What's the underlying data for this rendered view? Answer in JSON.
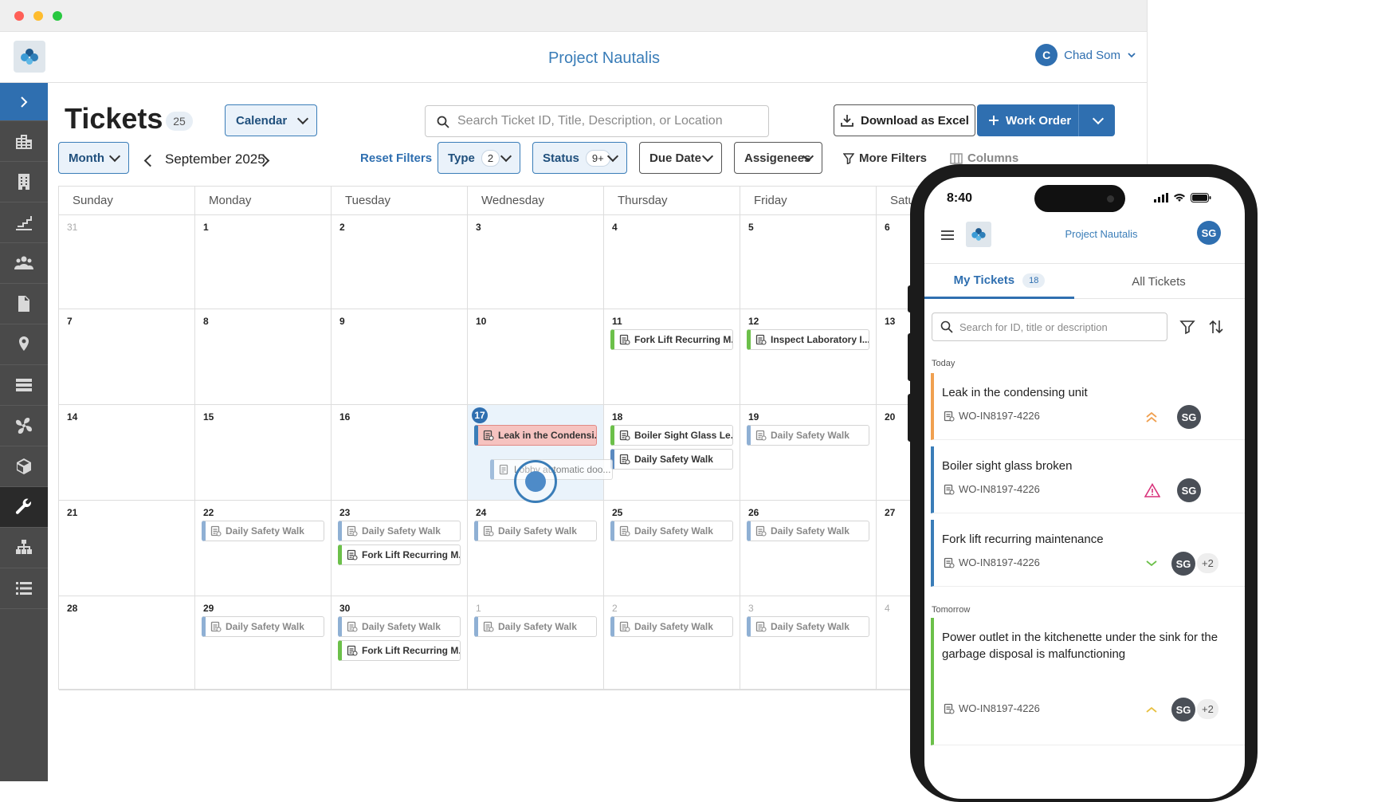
{
  "app": {
    "title": "Project Nautalis",
    "user_initial": "C",
    "user_name": "Chad Som"
  },
  "header": {
    "title": "Tickets",
    "count": "25",
    "view_select": "Calendar",
    "search_placeholder": "Search Ticket ID, Title, Description, or Location",
    "download_label": "Download as Excel",
    "work_order_label": "Work Order"
  },
  "filters": {
    "period": "Month",
    "month_label": "September 2025",
    "reset": "Reset Filters",
    "type_label": "Type",
    "type_count": "2",
    "status_label": "Status",
    "status_count": "9+",
    "due_date": "Due Date",
    "assignees": "Assigenees",
    "more_filters": "More Filters",
    "columns": "Columns"
  },
  "sidebar": {
    "icons": [
      "chevron-right-icon",
      "buildings-icon",
      "building-icon",
      "stairs-icon",
      "people-icon",
      "document-icon",
      "location-pin-icon",
      "server-icon",
      "fan-icon",
      "box-icon",
      "wrench-icon",
      "org-chart-icon",
      "list-icon"
    ],
    "active_index": 10
  },
  "calendar": {
    "days_of_week": [
      "Sunday",
      "Monday",
      "Tuesday",
      "Wednesday",
      "Thursday",
      "Friday",
      "Satu"
    ],
    "weeks": [
      [
        {
          "d": "31",
          "muted": true
        },
        {
          "d": "1"
        },
        {
          "d": "2"
        },
        {
          "d": "3"
        },
        {
          "d": "4"
        },
        {
          "d": "5"
        },
        {
          "d": "6"
        }
      ],
      [
        {
          "d": "7"
        },
        {
          "d": "8"
        },
        {
          "d": "9"
        },
        {
          "d": "10"
        },
        {
          "d": "11"
        },
        {
          "d": "12"
        },
        {
          "d": "13"
        }
      ],
      [
        {
          "d": "14"
        },
        {
          "d": "15"
        },
        {
          "d": "16"
        },
        {
          "d": "17",
          "today": true
        },
        {
          "d": "18"
        },
        {
          "d": "19"
        },
        {
          "d": "20"
        }
      ],
      [
        {
          "d": "21"
        },
        {
          "d": "22"
        },
        {
          "d": "23"
        },
        {
          "d": "24"
        },
        {
          "d": "25"
        },
        {
          "d": "26"
        },
        {
          "d": "27"
        }
      ],
      [
        {
          "d": "28"
        },
        {
          "d": "29"
        },
        {
          "d": "30"
        },
        {
          "d": "1",
          "muted": true
        },
        {
          "d": "2",
          "muted": true
        },
        {
          "d": "3",
          "muted": true
        },
        {
          "d": "4",
          "muted": true
        }
      ]
    ],
    "events": [
      {
        "week": 1,
        "day": 4,
        "slot": 0,
        "title": "Fork Lift Recurring M...",
        "style": "green"
      },
      {
        "week": 1,
        "day": 5,
        "slot": 0,
        "title": "Inspect Laboratory I...",
        "style": "green"
      },
      {
        "week": 2,
        "day": 3,
        "slot": 0,
        "title": "Leak in the Condensi...",
        "style": "red"
      },
      {
        "week": 2,
        "day": 4,
        "slot": 0,
        "title": "Boiler Sight Glass Le...",
        "style": "green"
      },
      {
        "week": 2,
        "day": 4,
        "slot": 1,
        "title": "Daily Safety Walk",
        "style": "blue"
      },
      {
        "week": 2,
        "day": 5,
        "slot": 0,
        "title": "Daily Safety Walk",
        "style": "faded"
      },
      {
        "week": 3,
        "day": 1,
        "slot": 0,
        "title": "Daily Safety Walk",
        "style": "faded"
      },
      {
        "week": 3,
        "day": 2,
        "slot": 0,
        "title": "Daily Safety Walk",
        "style": "faded"
      },
      {
        "week": 3,
        "day": 2,
        "slot": 1,
        "title": "Fork Lift Recurring M...",
        "style": "green"
      },
      {
        "week": 3,
        "day": 3,
        "slot": 0,
        "title": "Daily Safety Walk",
        "style": "faded"
      },
      {
        "week": 3,
        "day": 4,
        "slot": 0,
        "title": "Daily Safety Walk",
        "style": "faded"
      },
      {
        "week": 3,
        "day": 5,
        "slot": 0,
        "title": "Daily Safety Walk",
        "style": "faded"
      },
      {
        "week": 4,
        "day": 1,
        "slot": 0,
        "title": "Daily Safety Walk",
        "style": "faded"
      },
      {
        "week": 4,
        "day": 2,
        "slot": 0,
        "title": "Daily Safety Walk",
        "style": "faded"
      },
      {
        "week": 4,
        "day": 2,
        "slot": 1,
        "title": "Fork Lift Recurring M...",
        "style": "green"
      },
      {
        "week": 4,
        "day": 3,
        "slot": 0,
        "title": "Daily Safety Walk",
        "style": "faded"
      },
      {
        "week": 4,
        "day": 4,
        "slot": 0,
        "title": "Daily Safety Walk",
        "style": "faded"
      },
      {
        "week": 4,
        "day": 5,
        "slot": 0,
        "title": "Daily Safety Walk",
        "style": "faded"
      }
    ],
    "dragging_event": "Lobby automatic doo..."
  },
  "phone": {
    "time": "8:40",
    "title": "Project Nautalis",
    "avatar": "SG",
    "tabs": [
      {
        "label": "My Tickets",
        "count": "18"
      },
      {
        "label": "All Tickets"
      }
    ],
    "search_placeholder": "Search for ID, title or description",
    "sections": [
      "Today",
      "Tomorrow"
    ],
    "tickets": [
      {
        "title": "Leak in the condensing unit",
        "id": "WO-IN8197-4226",
        "priority": "high-double-chevron",
        "assignee": "SG",
        "extra": "",
        "color": "#f0a050"
      },
      {
        "title": "Boiler sight glass broken",
        "id": "WO-IN8197-4226",
        "priority": "warning-triangle",
        "assignee": "SG",
        "extra": "",
        "color": "#3a7db8"
      },
      {
        "title": "Fork lift recurring maintenance",
        "id": "WO-IN8197-4226",
        "priority": "low-chevron",
        "assignee": "SG",
        "extra": "+2",
        "color": "#3a7db8"
      },
      {
        "title": "Power outlet in the kitchenette under the sink for the garbage disposal is malfunctioning",
        "id": "WO-IN8197-4226",
        "priority": "medium-chevron",
        "assignee": "SG",
        "extra": "+2",
        "color": "#6cc04a"
      }
    ]
  }
}
